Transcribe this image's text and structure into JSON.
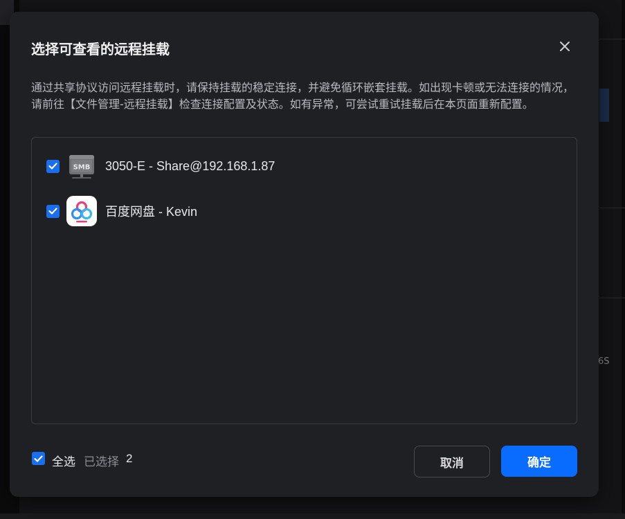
{
  "dialog": {
    "title": "选择可查看的远程挂载",
    "description": "通过共享协议访问远程挂载时，请保持挂载的稳定连接，并避免循环嵌套挂载。如出现卡顿或无法连接的情况，请前往【文件管理-远程挂载】检查连接配置及状态。如有异常，可尝试重试挂载后在本页面重新配置。",
    "items": [
      {
        "label": "3050-E - Share@192.168.1.87",
        "checked": true,
        "icon": "smb-drive-icon",
        "icon_text": "SMB"
      },
      {
        "label": "百度网盘 - Kevin",
        "checked": true,
        "icon": "baidu-netdisk-icon"
      }
    ],
    "footer": {
      "select_all_label": "全选",
      "selected_label": "已选择",
      "selected_count": "2",
      "cancel_label": "取消",
      "confirm_label": "确定"
    }
  },
  "background": {
    "side_text": "6S"
  },
  "colors": {
    "accent": "#0a6cff",
    "checkbox": "#1a6ff0",
    "dialog_bg": "#1f2023"
  }
}
